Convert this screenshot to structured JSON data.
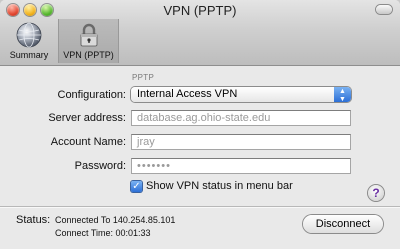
{
  "window": {
    "title": "VPN (PPTP)"
  },
  "toolbar": {
    "items": [
      {
        "label": "Summary",
        "icon": "globe-icon"
      },
      {
        "label": "VPN (PPTP)",
        "icon": "lock-icon"
      }
    ]
  },
  "form": {
    "section_header": "PPTP",
    "configuration_label": "Configuration:",
    "configuration_value": "Internal Access VPN",
    "server_label": "Server address:",
    "server_value": "database.ag.ohio-state.edu",
    "account_label": "Account Name:",
    "account_value": "jray",
    "password_label": "Password:",
    "password_value": "•••••••",
    "show_status_label": "Show VPN status in menu bar",
    "show_status_checked": true
  },
  "status": {
    "label": "Status:",
    "connected": "Connected To 140.254.85.101",
    "connect_time": "Connect Time: 00:01:33"
  },
  "buttons": {
    "disconnect": "Disconnect",
    "help": "?"
  },
  "colors": {
    "accent_blue": "#2c6fd6",
    "help_purple": "#6a2fa3"
  }
}
